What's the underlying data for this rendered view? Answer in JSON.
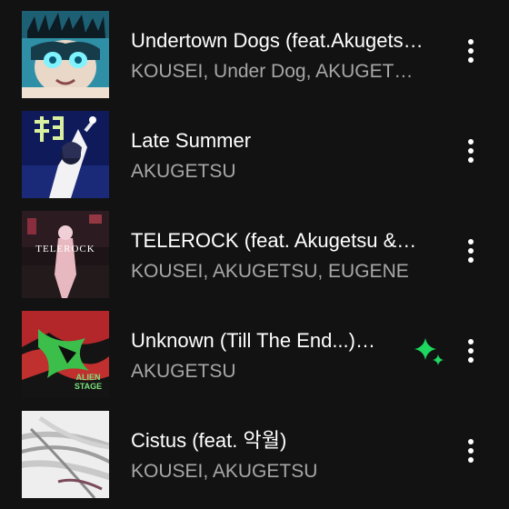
{
  "tracks": [
    {
      "title": "Undertown Dogs (feat.Akugets…",
      "artists": "KOUSEI, Under Dog, AKUGET…",
      "cover_icon": "undertown-dogs-cover",
      "has_sparkle": false
    },
    {
      "title": "Late Summer",
      "artists": "AKUGETSU",
      "cover_icon": "late-summer-cover",
      "has_sparkle": false
    },
    {
      "title": "TELEROCK (feat. Akugetsu &…",
      "artists": "KOUSEI, AKUGETSU, EUGENE",
      "cover_icon": "telerock-cover",
      "cover_text": "TELEROCK",
      "has_sparkle": false
    },
    {
      "title": "Unknown (Till The End...)…",
      "artists": "AKUGETSU",
      "cover_icon": "alien-stage-cover",
      "cover_text": "ALIEN STAGE",
      "has_sparkle": true,
      "sparkle_color": "#1ed760"
    },
    {
      "title": "Cistus (feat. 악월)",
      "artists": "KOUSEI, AKUGETSU",
      "cover_icon": "cistus-cover",
      "has_sparkle": false
    }
  ],
  "icons": {
    "more": "more-vertical-icon",
    "sparkle": "sparkle-icon"
  },
  "colors": {
    "background": "#121212",
    "title_text": "#ffffff",
    "subtitle_text": "#a7a7a7",
    "accent": "#1ed760"
  }
}
